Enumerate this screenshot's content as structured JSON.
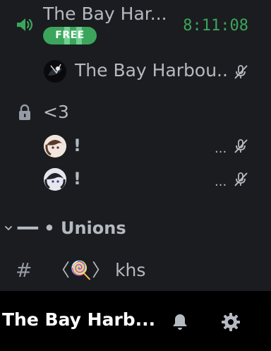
{
  "voice_channel": {
    "icon": "speaker-icon",
    "name": "The Bay Har...",
    "badge": "FREE",
    "timer": "8:11:08",
    "timer_color": "#3ba55c"
  },
  "voice_members": [
    {
      "name": "The Bay Harbou..",
      "avatar_icon": "avatar",
      "status_icon": "mic-muted-icon"
    }
  ],
  "locked_channel": {
    "icon": "lock-icon",
    "name": "<3",
    "members": [
      {
        "name": "!",
        "avatar_icon": "avatar",
        "overflow": "...",
        "status_icon": "mic-muted-icon"
      },
      {
        "name": "!",
        "avatar_icon": "avatar",
        "overflow": "...",
        "status_icon": "mic-muted-icon"
      }
    ]
  },
  "category": {
    "icon": "chevron-down-icon",
    "name": "━━ • Unions"
  },
  "text_channel": {
    "icon": "hash-icon",
    "name": "〈🍭〉 khs"
  },
  "bottom_bar": {
    "server_name": "The Bay Harb...",
    "bell_icon": "bell-icon",
    "settings_icon": "gear-icon"
  },
  "colors": {
    "background": "#1b1c1f",
    "bottom_bar": "#000000",
    "accent_green": "#3ba55c",
    "muted_text": "#b5bac1"
  }
}
